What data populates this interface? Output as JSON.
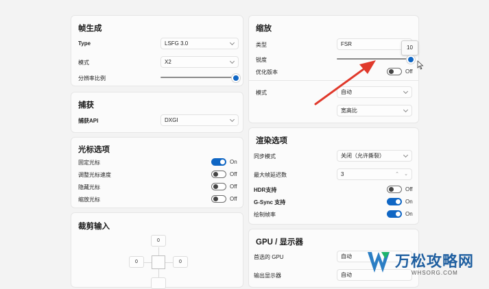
{
  "frame_gen": {
    "title": "帧生成",
    "type_label": "Type",
    "type_value": "LSFG 3.0",
    "mode_label": "模式",
    "mode_value": "X2",
    "resolution_label": "分辨率比例"
  },
  "capture": {
    "title": "捕获",
    "api_label": "捕获API",
    "api_value": "DXGI"
  },
  "cursor": {
    "title": "光标选项",
    "items": [
      {
        "label": "固定光标",
        "state": "On",
        "on": true
      },
      {
        "label": "调整光标速度",
        "state": "Off",
        "on": false
      },
      {
        "label": "隐藏光标",
        "state": "Off",
        "on": false
      },
      {
        "label": "缩放光标",
        "state": "Off",
        "on": false
      }
    ]
  },
  "crop": {
    "title": "裁剪输入",
    "top": "0",
    "left": "0",
    "right": "0"
  },
  "scaling": {
    "title": "缩放",
    "type_label": "类型",
    "type_value": "FSR",
    "sharpness_label": "锐度",
    "sharpness_value": "10",
    "optimize_label": "优化版本",
    "optimize_state": "Off",
    "mode_label": "模式",
    "mode_value": "自动",
    "aspect_value": "宽高比"
  },
  "render": {
    "title": "渲染选项",
    "sync_label": "同步模式",
    "sync_value": "关闭（允许撕裂）",
    "max_frame_label": "最大帧延迟数",
    "max_frame_value": "3",
    "hdr_label": "HDR支持",
    "hdr_state": "Off",
    "gsync_label": "G-Sync 支持",
    "gsync_state": "On",
    "framerate_label": "绘制帧率",
    "framerate_state": "On"
  },
  "gpu": {
    "title": "GPU / 显示器",
    "gpu_label": "首选的 GPU",
    "gpu_value": "自动",
    "monitor_label": "输出显示器",
    "monitor_value": "自动"
  },
  "watermark": {
    "name": "万松攻略网",
    "url": "WHSORG.COM"
  },
  "colors": {
    "accent": "#0f66c4",
    "annotation_arrow": "#e0392b"
  }
}
